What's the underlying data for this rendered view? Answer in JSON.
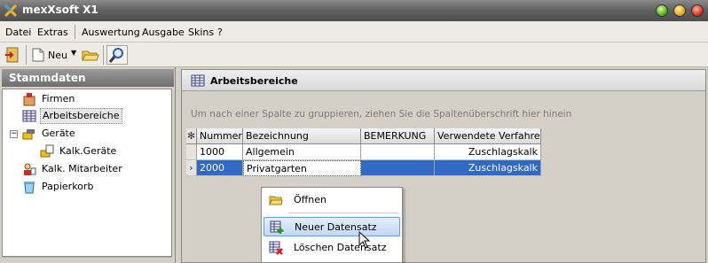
{
  "window": {
    "title": "mexXsoft X1",
    "app_icon": "mexxsoft-logo-icon"
  },
  "menu": {
    "items": [
      "Datei",
      "Extras",
      "Auswertung",
      "Ausgabe",
      "Skins",
      "?"
    ]
  },
  "toolbar": {
    "new_label": "Neu",
    "buttons": [
      "exit-icon",
      "new-document-icon",
      "open-folder-icon",
      "search-icon"
    ]
  },
  "sidebar": {
    "title": "Stammdaten",
    "items": [
      {
        "label": "Firmen",
        "icon": "company-icon"
      },
      {
        "label": "Arbeitsbereiche",
        "icon": "table-icon"
      },
      {
        "label": "Geräte",
        "icon": "devices-icon",
        "expander": "−"
      },
      {
        "label": "Kalk.Geräte",
        "icon": "calc-devices-icon"
      },
      {
        "label": "Kalk. Mitarbeiter",
        "icon": "employee-icon"
      },
      {
        "label": "Papierkorb",
        "icon": "trash-icon"
      }
    ]
  },
  "main": {
    "title": "Arbeitsbereiche",
    "group_hint": "Um nach einer Spalte zu gruppieren, ziehen Sie die Spaltenüberschrift hier hinein",
    "grid": {
      "indicator_header": "✻",
      "columns": [
        "Nummer",
        "Bezeichnung",
        "BEMERKUNG",
        "Verwendete Verfahren"
      ],
      "rows": [
        {
          "indicator": "",
          "cells": [
            "1000",
            "Allgemein",
            "",
            "Zuschlagskalk"
          ]
        },
        {
          "indicator": "›",
          "cells": [
            "2000",
            "Privatgarten",
            "",
            "Zuschlagskalk"
          ]
        }
      ]
    }
  },
  "context_menu": {
    "items": [
      {
        "label": "Öffnen",
        "icon": "folder-open-icon"
      },
      {
        "label": "Neuer Datensatz",
        "icon": "new-record-icon"
      },
      {
        "label": "Löschen Datensatz",
        "icon": "delete-record-icon"
      }
    ]
  },
  "colors": {
    "selection": "#3169c6",
    "title_bar": "#5f5f5f",
    "panel_bg": "#d4d0c8"
  }
}
